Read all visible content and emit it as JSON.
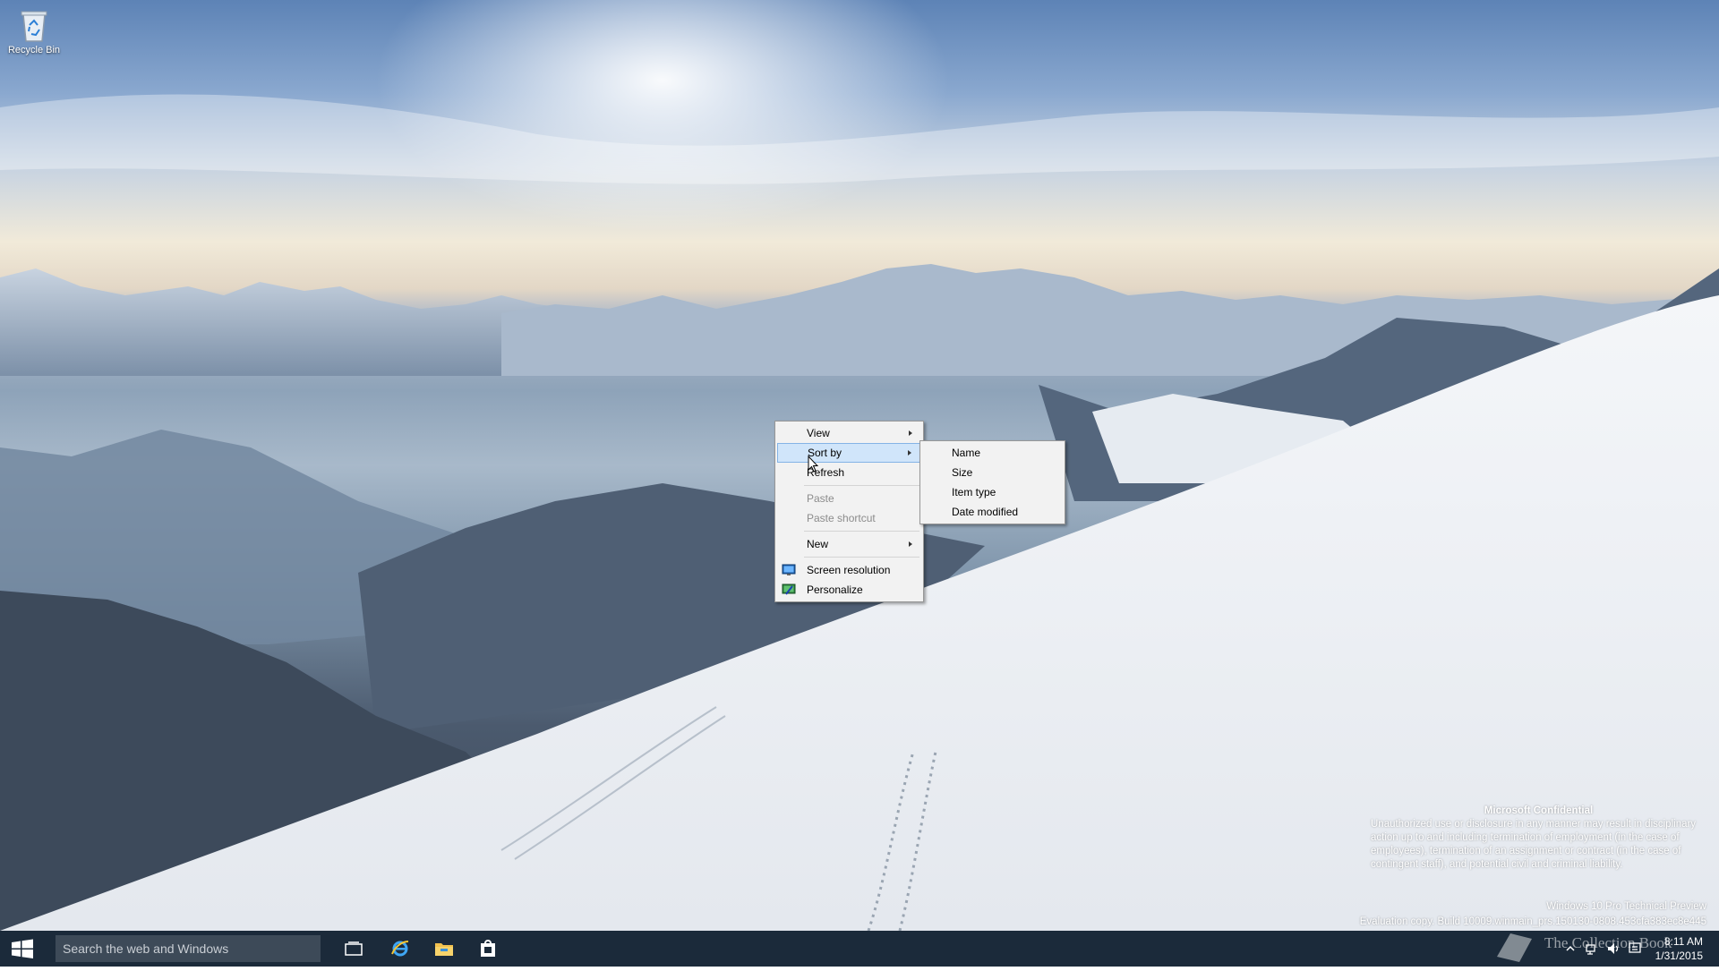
{
  "desktop": {
    "icons": [
      {
        "label": "Recycle Bin",
        "icon": "recycle-bin-icon"
      }
    ]
  },
  "context_menu": {
    "items": [
      {
        "label": "View",
        "has_submenu": true
      },
      {
        "label": "Sort by",
        "has_submenu": true,
        "highlighted": true
      },
      {
        "label": "Refresh"
      },
      {
        "label": "Paste",
        "disabled": true
      },
      {
        "label": "Paste shortcut",
        "disabled": true
      },
      {
        "label": "New",
        "has_submenu": true
      },
      {
        "label": "Screen resolution",
        "icon": "display-icon"
      },
      {
        "label": "Personalize",
        "icon": "personalize-icon"
      }
    ]
  },
  "sort_submenu": {
    "items": [
      {
        "label": "Name"
      },
      {
        "label": "Size"
      },
      {
        "label": "Item type"
      },
      {
        "label": "Date modified"
      }
    ]
  },
  "watermark": {
    "heading": "Microsoft Confidential",
    "body": "Unauthorized use or disclosure in any manner may result in disciplinary action up to and including termination of employment (in the case of employees), termination of an assignment or contract (in the case of contingent staff), and potential civil and criminal liability.",
    "product": "Windows 10 Pro Technical Preview",
    "build": "Evaluation copy. Build 10009.winmain_prs.150130-0808.453cfa383ec8e445"
  },
  "taskbar": {
    "search_placeholder": "Search the web and Windows",
    "apps": [
      "task-view-icon",
      "internet-explorer-icon",
      "file-explorer-icon",
      "store-icon"
    ],
    "clock_time": "8:11 AM",
    "clock_date": "1/31/2015",
    "watermark_text": "The Collection Book"
  },
  "colors": {
    "taskbar": "#1b2a3a",
    "menu_bg": "#f2f2f2",
    "menu_highlight": "#d0e5fa"
  }
}
